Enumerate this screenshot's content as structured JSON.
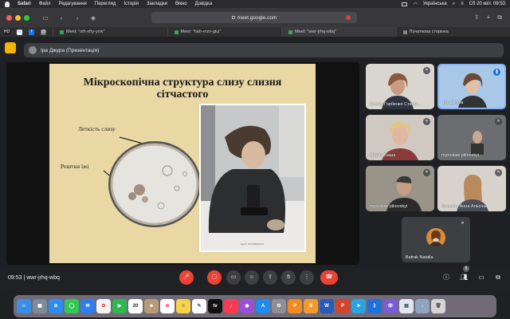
{
  "menubar": {
    "items": [
      "Safari",
      "Файл",
      "Редагування",
      "Перегляд",
      "Історія",
      "Закладки",
      "Вікно",
      "Довідка"
    ],
    "keyboard": "Українська",
    "datetime": "Сб 20 квіт.  09:53"
  },
  "browser": {
    "url": "meet.google.com",
    "favorites": [
      {
        "label": "HD",
        "icon": "hd-icon"
      },
      {
        "label": "",
        "icon": "google-icon"
      },
      {
        "label": "",
        "icon": "facebook-icon"
      },
      {
        "label": "",
        "icon": "email-icon"
      }
    ],
    "tabs": [
      {
        "label": "Meet: \"oih-xfry-yxiv\""
      },
      {
        "label": "Meet: \"hah-vrzn-gkz\""
      },
      {
        "label": "Meet: \"wwr-jrhq-wbq\""
      },
      {
        "label": "Початкова сторінка"
      }
    ]
  },
  "presentation": {
    "presenter_label": "Іра Джура (Презентація)"
  },
  "slide": {
    "title_line1": "Мікроскопічна структура слизу слизня",
    "title_line2": "сітчастого",
    "label_mucus": "Леткість слизу",
    "label_food": "Рештки їжі",
    "watermark": "щоб активувати"
  },
  "participants": [
    {
      "name": "Олена Горбенко Статін...",
      "muted": true
    },
    {
      "name": "Іра Джура",
      "muted": false,
      "speaking": true
    },
    {
      "name": "Олена Баша",
      "muted": true
    },
    {
      "name": "myroslaw pikovskyi",
      "muted": true
    },
    {
      "name": "myroslaw pikovskyi",
      "muted": true
    },
    {
      "name": "Кузьмич Анна Альсіна",
      "muted": true
    },
    {
      "name": "Batrak Natalia",
      "muted": true
    }
  ],
  "meeting": {
    "time": "09:53",
    "code": "wwr-jrhq-wbq",
    "people_count": "8"
  },
  "colors": {
    "end_call": "#ea4335",
    "meet_bg": "#202124",
    "tile_bg": "#3c4043",
    "slide_bg": "#e9d8a4"
  },
  "dock": {
    "calendar_day": "20",
    "apps": [
      "finder-icon",
      "launchpad-icon",
      "safari-icon",
      "messages-icon",
      "mail-icon",
      "photos-icon",
      "facetime-icon",
      "calendar-icon",
      "contacts-icon",
      "reminders-icon",
      "notes-icon",
      "freeform-icon",
      "appletv-icon",
      "music-icon",
      "podcasts-icon",
      "appstore-icon",
      "settings-icon",
      "pages-icon",
      "books-icon",
      "word-icon",
      "powerpoint-icon",
      "telegram-icon",
      "bluetooth-icon",
      "viber-icon",
      "preview-icon",
      "downloads-icon",
      "trash-icon"
    ]
  }
}
